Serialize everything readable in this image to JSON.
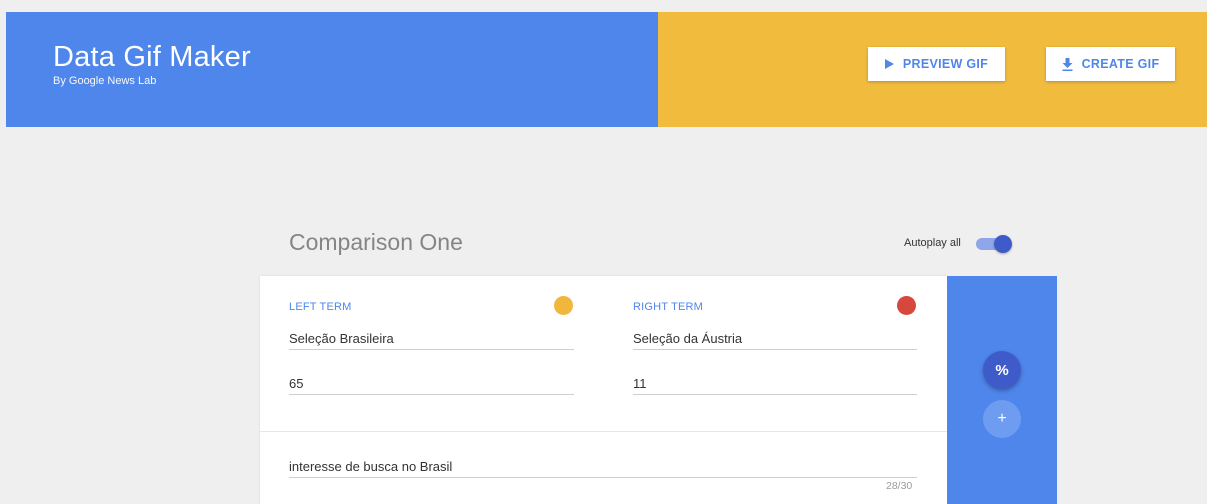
{
  "header": {
    "title": "Data Gif Maker",
    "subtitle": "By Google News Lab",
    "preview_label": "PREVIEW GIF",
    "create_label": "CREATE GIF",
    "colors": {
      "blue": "#4f86ec",
      "yellow": "#f1bc3e"
    }
  },
  "comparison": {
    "title": "Comparison One",
    "autoplay_label": "Autoplay all",
    "autoplay_on": true,
    "left": {
      "label": "LEFT TERM",
      "name": "Seleção Brasileira",
      "value": "65",
      "color": "#f0b73c"
    },
    "right": {
      "label": "RIGHT TERM",
      "name": "Seleção da Áustria",
      "value": "11",
      "color": "#d6483e"
    },
    "description": "interesse de busca no Brasil",
    "char_counter": "28/30",
    "percent_button": "%",
    "add_button": "+"
  }
}
